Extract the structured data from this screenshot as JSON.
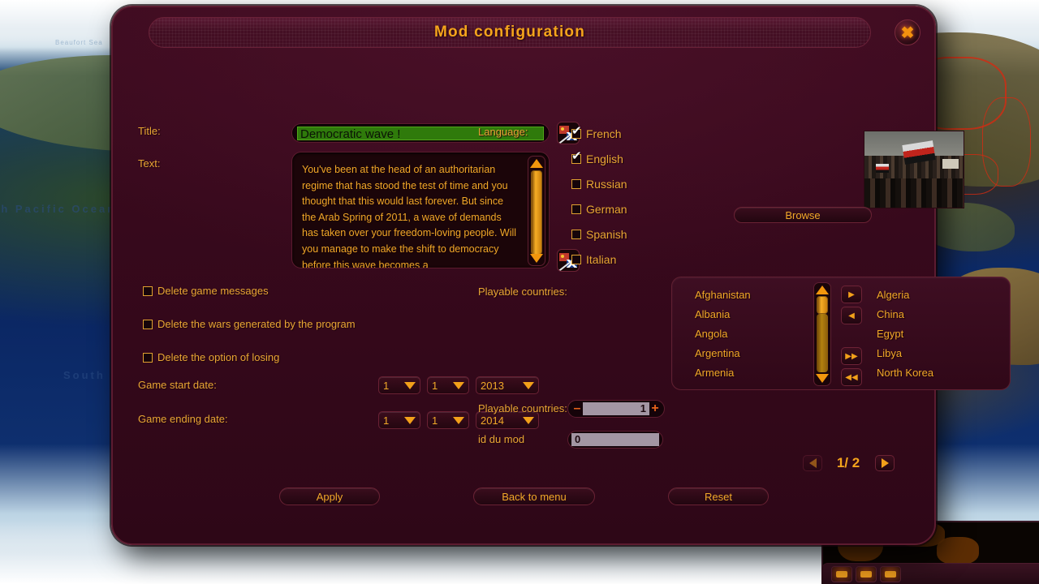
{
  "window": {
    "title": "Mod configuration",
    "close_icon": "close-x-icon"
  },
  "form": {
    "title_label": "Title:",
    "title_value": "Democratic wave !",
    "text_label": "Text:",
    "text_value": "You've been at the head of an authoritarian regime that has stood the test of time and you thought that this would last forever. But since the Arab Spring of 2011, a wave of demands has taken over your freedom-loving people. Will you manage to make the shift to democracy before this wave becomes a",
    "flag_button_icon": "flag-translate-icon"
  },
  "options": [
    {
      "label": "Delete game messages",
      "checked": false
    },
    {
      "label": "Delete the wars generated by the program",
      "checked": false
    },
    {
      "label": "Delete the option of losing",
      "checked": false
    }
  ],
  "dates": {
    "start_label": "Game start date:",
    "start": {
      "day": "1",
      "month": "1",
      "year": "2013"
    },
    "end_label": "Game ending date:",
    "end": {
      "day": "1",
      "month": "1",
      "year": "2014"
    }
  },
  "language": {
    "label": "Language:",
    "items": [
      {
        "label": "French",
        "checked": true
      },
      {
        "label": "English",
        "checked": true
      },
      {
        "label": "Russian",
        "checked": false
      },
      {
        "label": "German",
        "checked": false
      },
      {
        "label": "Spanish",
        "checked": false
      },
      {
        "label": "Italian",
        "checked": false
      }
    ]
  },
  "preview": {
    "browse_label": "Browse",
    "image_alt": "crowd-protest-photo"
  },
  "countries": {
    "label": "Playable countries:",
    "available": [
      "Afghanistan",
      "Albania",
      "Angola",
      "Argentina",
      "Armenia"
    ],
    "selected": [
      "Algeria",
      "China",
      "Egypt",
      "Libya",
      "North Korea"
    ],
    "transfer": [
      {
        "icon": "arrow-right-icon",
        "glyph": "▶"
      },
      {
        "icon": "arrow-left-icon",
        "glyph": "◀"
      },
      {
        "icon": "double-arrow-right-icon",
        "glyph": "▶▶"
      },
      {
        "icon": "double-arrow-left-icon",
        "glyph": "◀◀"
      }
    ]
  },
  "counters": {
    "playable_label": "Playable countries:",
    "playable_value": "1",
    "minus": "–",
    "plus": "+",
    "modid_label": "id du mod",
    "modid_value": "0"
  },
  "pager": {
    "prev_icon": "chevron-left-icon",
    "next_icon": "chevron-right-icon",
    "text": "1/ 2"
  },
  "actions": {
    "apply": "Apply",
    "back": "Back to menu",
    "reset": "Reset"
  },
  "background": {
    "ocean_label_north": "th Pacific Ocean",
    "ocean_label_south": "South",
    "sea_label": "Beaufort Sea"
  },
  "colors": {
    "amber": "#f0a828",
    "title_gold": "#f4a41c",
    "panel": "#3d0b1f",
    "field_green": "#2f7a0b"
  }
}
